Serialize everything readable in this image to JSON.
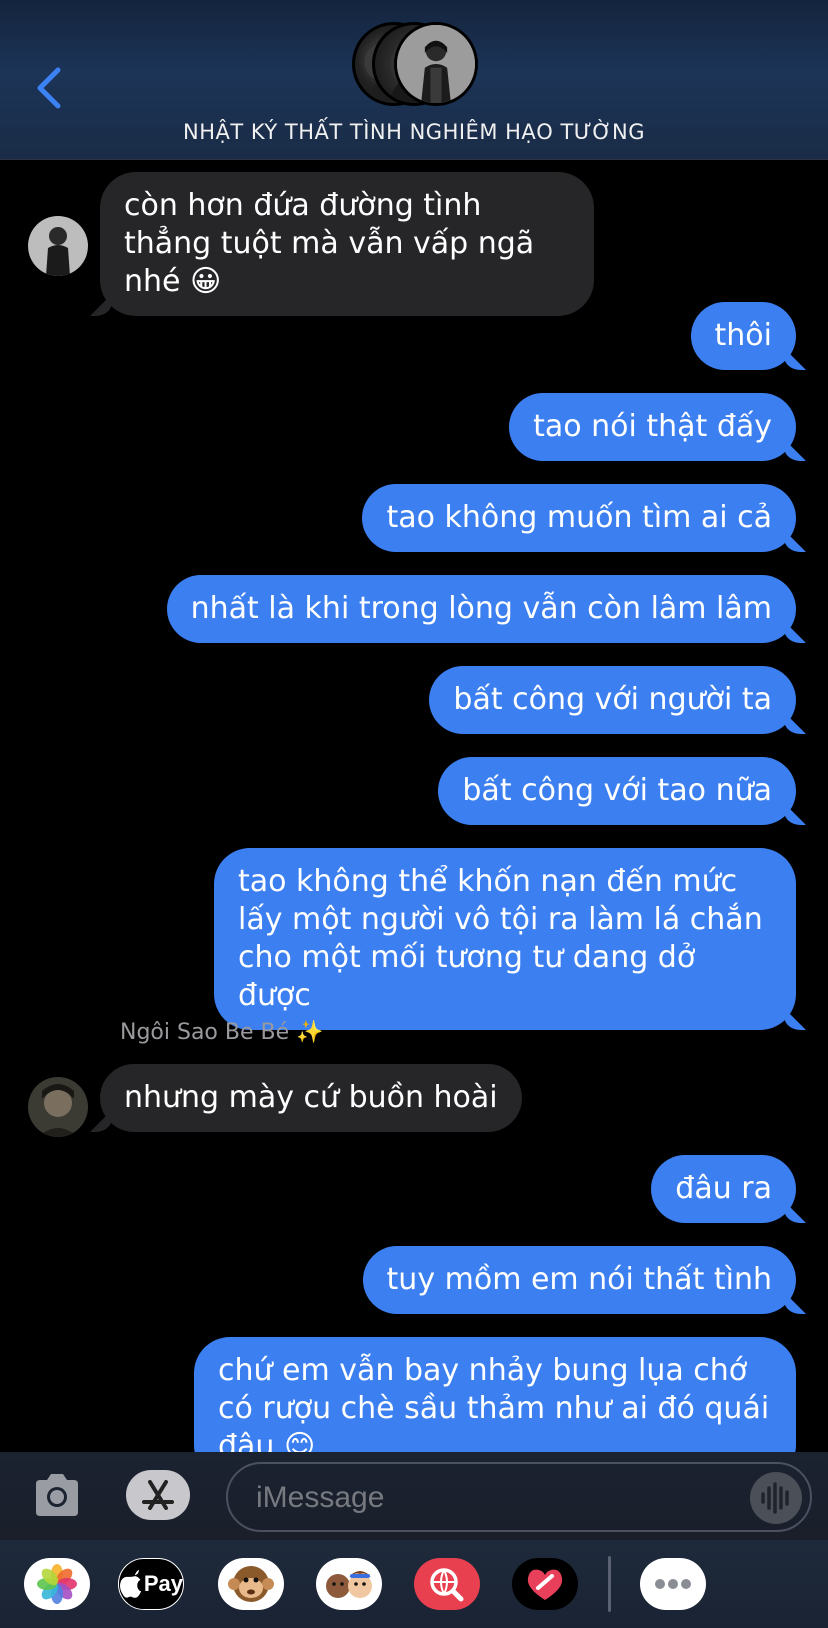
{
  "header": {
    "group_name": "NHẬT KÝ THẤT TÌNH NGHIÊM HẠO TƯỜNG"
  },
  "messages": [
    {
      "dir": "in",
      "text": "còn hơn đứa đường tình thẳng tuột mà vẫn vấp ngã nhé 😀"
    },
    {
      "dir": "out",
      "text": "thôi"
    },
    {
      "dir": "out",
      "text": "tao nói thật đấy"
    },
    {
      "dir": "out",
      "text": "tao không muốn tìm ai cả"
    },
    {
      "dir": "out",
      "text": "nhất là khi trong lòng vẫn còn lâm lâm"
    },
    {
      "dir": "out",
      "text": "bất công với người ta"
    },
    {
      "dir": "out",
      "text": "bất công với tao nữa"
    },
    {
      "dir": "out",
      "text": "tao không thể khốn nạn đến mức lấy một người vô tội ra làm lá chắn cho một mối tương tư dang dở được"
    },
    {
      "dir": "in",
      "sender": "Ngôi Sao Be Bé ✨",
      "text": "nhưng mày cứ buồn hoài"
    },
    {
      "dir": "out",
      "text": "đâu ra"
    },
    {
      "dir": "out",
      "text": "tuy mồm em nói thất tình"
    },
    {
      "dir": "out",
      "text": "chứ em vẫn bay nhảy bung lụa chớ có rượu chè sầu thảm như ai đó quái đâu 😊"
    }
  ],
  "input": {
    "placeholder": "iMessage"
  },
  "drawer": {
    "apple_pay_label": "Pay",
    "apps": [
      "photos-icon",
      "apple-pay-icon",
      "monkey-memoji-icon",
      "memoji-icon",
      "web-search-icon",
      "digital-touch-icon",
      "more-icon"
    ]
  },
  "colors": {
    "outgoing_bubble": "#3b7ff0",
    "incoming_bubble": "#262628",
    "accent": "#3b82f6"
  }
}
